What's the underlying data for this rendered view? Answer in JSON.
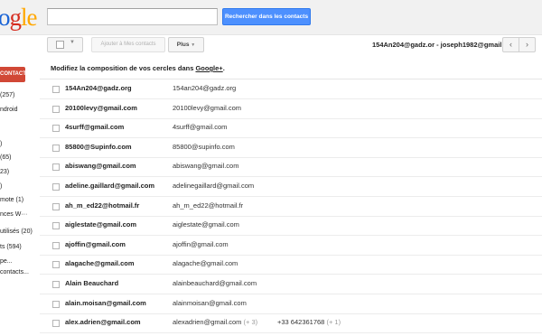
{
  "header": {
    "logo_parts": [
      "o",
      "g",
      "le"
    ],
    "search": {
      "value": "",
      "placeholder": ""
    },
    "search_button": "Rechercher dans les contacts"
  },
  "toolbar": {
    "add_me_label": "Ajouter à Mes contacts",
    "more_label": "Plus",
    "account": "154An204@gadz.or - joseph1982@gmail",
    "prev": "‹",
    "next": "›"
  },
  "sidebar": {
    "new_contact": "CONTACT",
    "items": [
      "(257)",
      "ndroid",
      ")",
      "(65)",
      "23)",
      ")",
      "mote (1)",
      "nces W···",
      " utilisés (20)",
      "ts (594)",
      "pe...",
      "contacts..."
    ]
  },
  "notice": {
    "text": "Modifiez la composition de vos cercles dans ",
    "link": "Google+",
    "suffix": "."
  },
  "contacts": [
    {
      "name": "154An204@gadz.org",
      "email": "154an204@gadz.org"
    },
    {
      "name": "20100levy@gmail.com",
      "email": "20100levy@gmail.com"
    },
    {
      "name": "4surff@gmail.com",
      "email": "4surff@gmail.com"
    },
    {
      "name": "85800@Supinfo.com",
      "email": "85800@supinfo.com"
    },
    {
      "name": "abiswang@gmail.com",
      "email": "abiswang@gmail.com"
    },
    {
      "name": "adeline.gaillard@gmail.com",
      "email": "adelinegaillard@gmail.com"
    },
    {
      "name": "ah_m_ed22@hotmail.fr",
      "email": "ah_m_ed22@hotmail.fr"
    },
    {
      "name": "aiglestate@gmail.com",
      "email": "aiglestate@gmail.com"
    },
    {
      "name": "ajoffin@gmail.com",
      "email": "ajoffin@gmail.com"
    },
    {
      "name": "alagache@gmail.com",
      "email": "alagache@gmail.com"
    },
    {
      "name": "Alain Beauchard",
      "email": "alainbeauchard@gmail.com"
    },
    {
      "name": "alain.moisan@gmail.com",
      "email": "alainmoisan@gmail.com"
    },
    {
      "name": "alex.adrien@gmail.com",
      "email": "alexadrien@gmail.com",
      "email_extra": "(+ 3)",
      "phone": "+33 642361768",
      "phone_extra": "(+ 1)"
    }
  ]
}
